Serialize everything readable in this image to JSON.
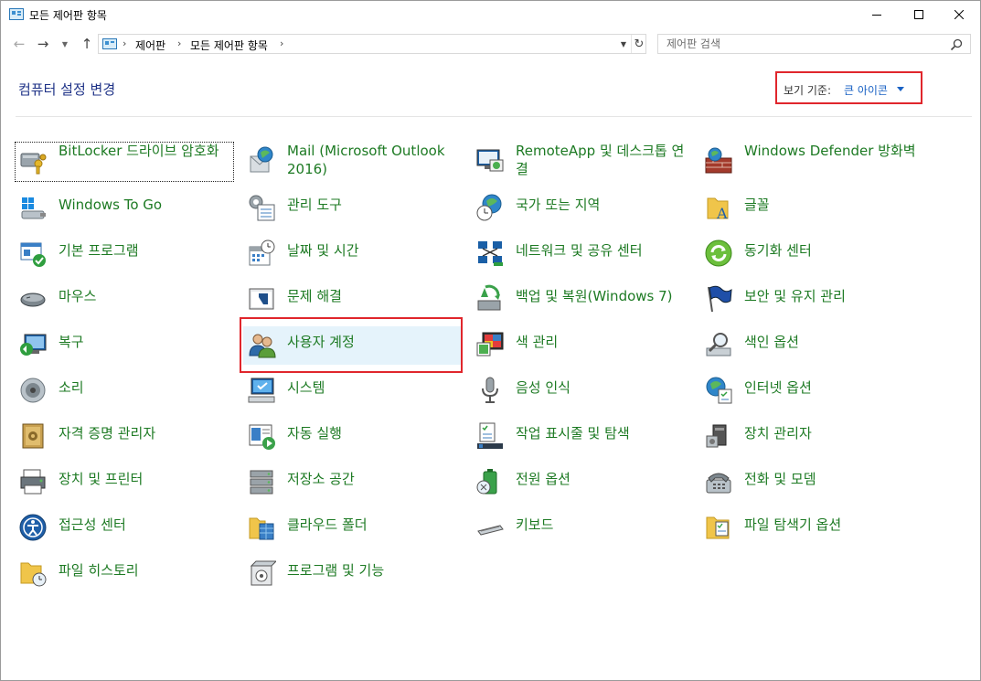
{
  "window": {
    "title": "모든 제어판 항목",
    "controls": {
      "minimize_icon": "minimize-icon",
      "maximize_icon": "maximize-icon",
      "close_icon": "close-icon"
    }
  },
  "addressbar": {
    "breadcrumbs": [
      "제어판",
      "모든 제어판 항목"
    ],
    "separator": "›"
  },
  "search": {
    "placeholder": "제어판 검색"
  },
  "header": {
    "title": "컴퓨터 설정 변경",
    "view_by_label": "보기 기준:",
    "view_by_value": "큰 아이콘"
  },
  "colors": {
    "link_green": "#1d7a23",
    "title_blue": "#1e3287",
    "highlight_red": "#e0262c",
    "selected_bg": "#e5f3fb"
  },
  "items": [
    [
      "BitLocker 드라이브 암호화",
      "Mail (Microsoft Outlook 2016)",
      "RemoteApp 및 데스크톱 연결",
      "Windows Defender 방화벽"
    ],
    [
      "Windows To Go",
      "관리 도구",
      "국가 또는 지역",
      "글꼴"
    ],
    [
      "기본 프로그램",
      "날짜 및 시간",
      "네트워크 및 공유 센터",
      "동기화 센터"
    ],
    [
      "마우스",
      "문제 해결",
      "백업 및 복원(Windows 7)",
      "보안 및 유지 관리"
    ],
    [
      "복구",
      "사용자 계정",
      "색 관리",
      "색인 옵션"
    ],
    [
      "소리",
      "시스템",
      "음성 인식",
      "인터넷 옵션"
    ],
    [
      "자격 증명 관리자",
      "자동 실행",
      "작업 표시줄 및 탐색",
      "장치 관리자"
    ],
    [
      "장치 및 프린터",
      "저장소 공간",
      "전원 옵션",
      "전화 및 모뎀"
    ],
    [
      "접근성 센터",
      "클라우드 폴더",
      "키보드",
      "파일 탐색기 옵션"
    ],
    [
      "파일 히스토리",
      "프로그램 및 기능"
    ]
  ]
}
